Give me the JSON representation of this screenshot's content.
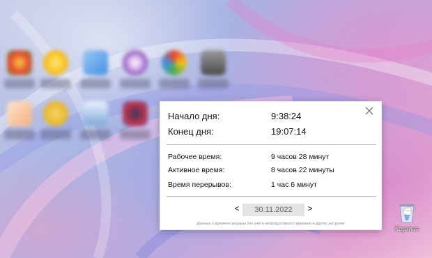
{
  "desktop": {
    "icons": [
      {
        "name": "desktop-icon-1",
        "color": "#e8452c"
      },
      {
        "name": "desktop-icon-2",
        "color": "#f6c21b"
      },
      {
        "name": "desktop-icon-3",
        "color": "#3f8fe0"
      },
      {
        "name": "desktop-icon-4",
        "color": "#8b4fb8"
      },
      {
        "name": "desktop-icon-5",
        "color": "#4caf50"
      },
      {
        "name": "desktop-icon-6",
        "color": "#6b6b6b"
      },
      {
        "name": "desktop-icon-7",
        "color": "#f4b183"
      },
      {
        "name": "desktop-icon-8",
        "color": "#e6b422"
      },
      {
        "name": "desktop-icon-9",
        "color": "#7fa7d8"
      },
      {
        "name": "desktop-icon-10",
        "color": "#c2304a"
      }
    ],
    "recycle_bin_label": "Корзина"
  },
  "panel": {
    "day_start_label": "Начало дня:",
    "day_start_value": "9:38:24",
    "day_end_label": "Конец дня:",
    "day_end_value": "19:07:14",
    "work_time_label": "Рабочее время:",
    "work_time_value": "9 часов 28 минут",
    "active_time_label": "Активное время:",
    "active_time_value": "8 часов 22 минуты",
    "break_time_label": "Время перерывов:",
    "break_time_value": "1 час 6 минут",
    "prev_label": "<",
    "next_label": ">",
    "date": "30.11.2022",
    "footnote": "Данные о времени указаны без учёта непродуктивного времени и других настроек"
  }
}
